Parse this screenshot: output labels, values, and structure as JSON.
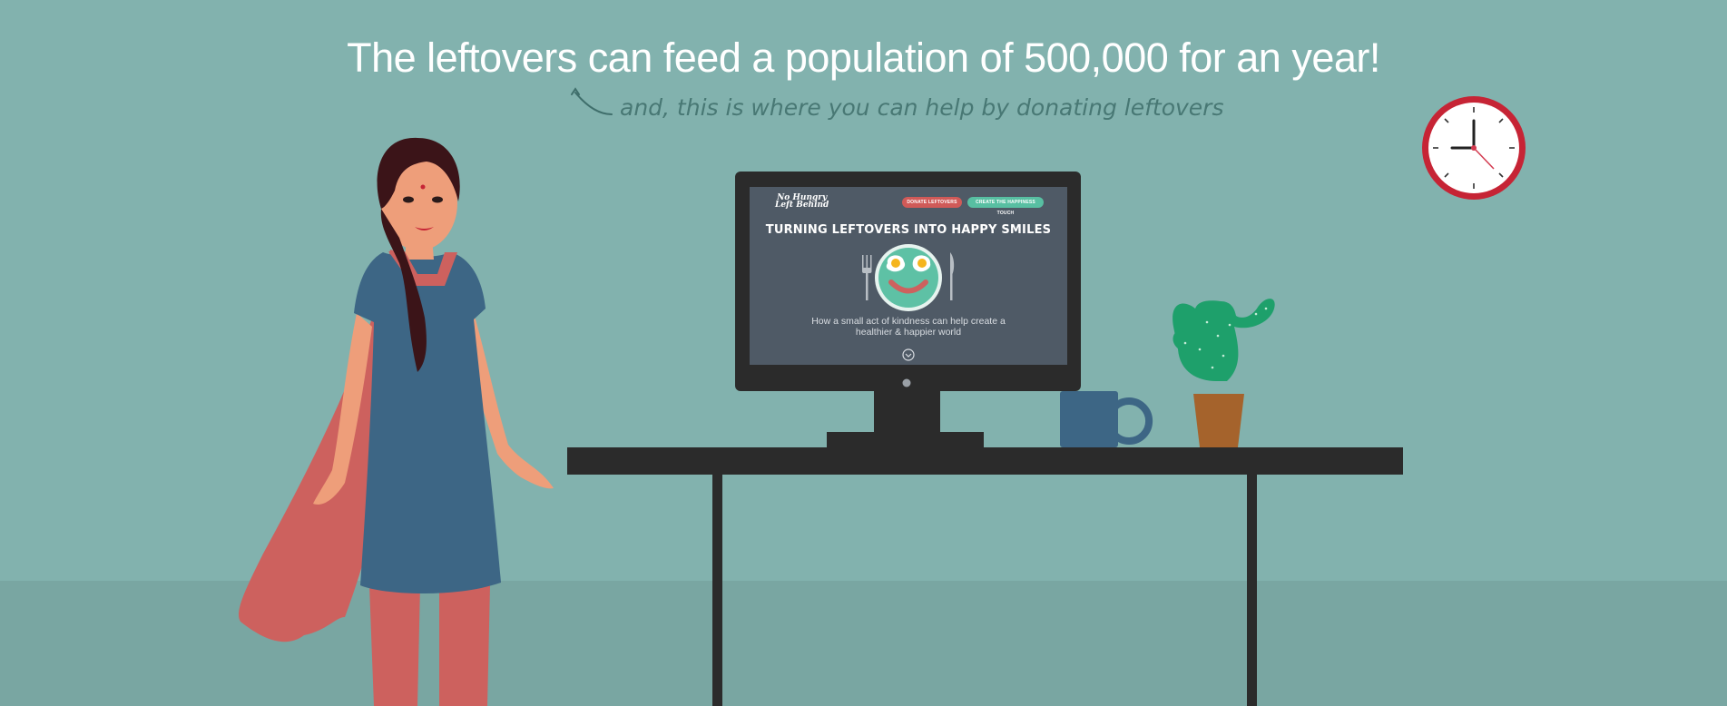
{
  "headline": "The leftovers can feed a population of 500,000 for an year!",
  "subheadline": "and, this is where you can help by donating leftovers",
  "screen": {
    "logo_line1": "No Hungry",
    "logo_line2": "Left Behind",
    "donate_button": "DONATE LEFTOVERS",
    "create_button": "CREATE THE HAPPINESS TOUCH",
    "title": "TURNING LEFTOVERS INTO HAPPY SMILES",
    "description": "How a small act of kindness can help create a healthier & happier world"
  },
  "colors": {
    "background": "#82b2ae",
    "floor": "#79a6a2",
    "desk": "#2b2b2b",
    "dress": "#3d6685",
    "dupatta": "#cd615e",
    "skin": "#ee9e7a",
    "hair": "#3b1418",
    "clock_rim": "#c62435",
    "cactus": "#1ea06b",
    "pot": "#a5632c",
    "mug": "#3d6685",
    "screen_bg": "#4f5a66",
    "plate": "#5ec1a5"
  },
  "clock": {
    "hour_hand": "9",
    "minute_hand": "12",
    "second_hand": "about 4:25"
  }
}
